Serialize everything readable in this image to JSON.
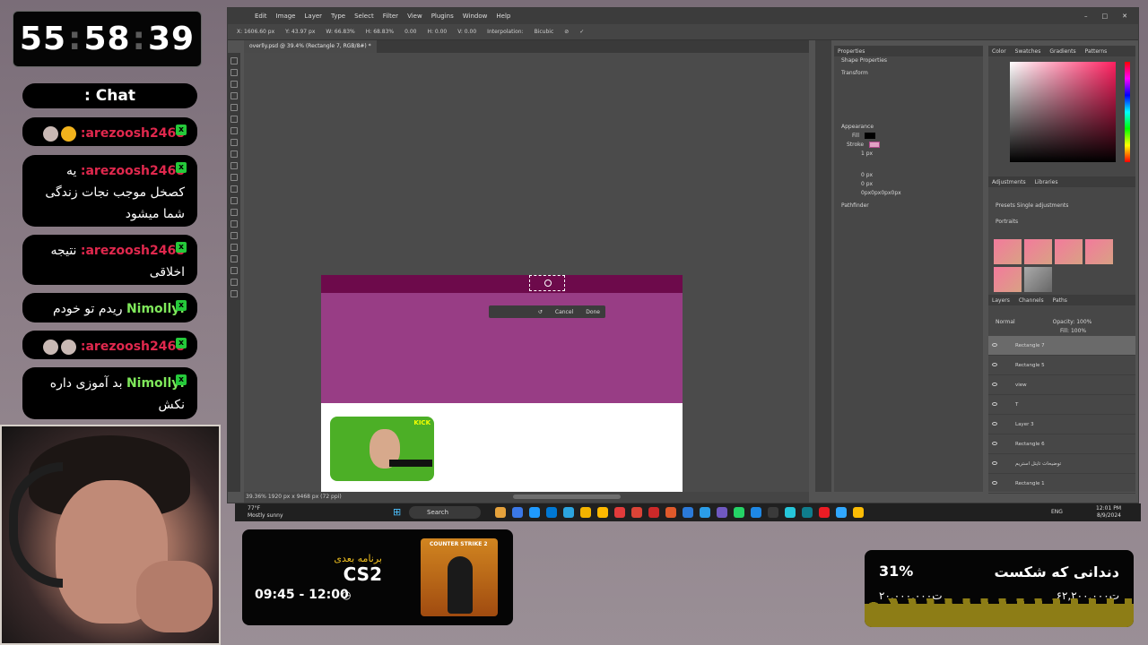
{
  "timer": {
    "h": "55",
    "m": "58",
    "s": "39"
  },
  "chat": {
    "title": ": Chat",
    "messages": [
      {
        "user": ":arezoosh2468",
        "text": ""
      },
      {
        "user": ":arezoosh2468",
        "text": "یه کصخل موجب نجات زندگی شما میشود"
      },
      {
        "user": ":arezoosh2468",
        "text": "نتیجه اخلاقی"
      },
      {
        "user": "Nimolly:",
        "text": "ریدم تو خودم"
      },
      {
        "user": ":arezoosh2468",
        "text": ""
      },
      {
        "user": "Nimolly:",
        "text": "بد آموزی داره نکش"
      }
    ],
    "badge": "x",
    "colors": {
      "user_red": "#e0284d",
      "user_green": "#7fe85b",
      "badge": "#25c93a"
    }
  },
  "photoshop": {
    "menu": [
      "Edit",
      "Image",
      "Layer",
      "Type",
      "Select",
      "Filter",
      "View",
      "Plugins",
      "Window",
      "Help"
    ],
    "options": {
      "x": "X: 1606.60 px",
      "y": "Y: 43.97 px",
      "w": "W: 66.83%",
      "h": "H: 68.83%",
      "angle": "0.00",
      "hskew": "H: 0.00",
      "vskew": "V: 0.00",
      "interp_label": "Interpolation:",
      "interp_value": "Bicubic"
    },
    "tab": "overlly.psd @ 39.4% (Rectangle 7, RGB/8#) *",
    "transform": {
      "cancel": "Cancel",
      "done": "Done"
    },
    "status": {
      "zoom": "39.36%",
      "size": "1920 px x 9468 px (72 ppi)"
    },
    "thumb_tag": "KICK",
    "properties": {
      "tabs": [
        "Properties"
      ],
      "subtitle": "Shape Properties",
      "sections": {
        "transform": "Transform",
        "appearance": "Appearance",
        "pathfinder": "Pathfinder"
      },
      "fill_label": "Fill",
      "stroke_label": "Stroke",
      "stroke_size": "1 px",
      "radius": "0 px",
      "corner": "0px0px0px0px"
    },
    "color": {
      "tabs": [
        "Color",
        "Swatches",
        "Gradients",
        "Patterns"
      ]
    },
    "adjustments": {
      "tabs": [
        "Adjustments",
        "Libraries"
      ],
      "subtabs": [
        "Presets",
        "Single adjustments"
      ],
      "group": "Portraits"
    },
    "layers": {
      "tabs": [
        "Layers",
        "Channels",
        "Paths"
      ],
      "blend": "Normal",
      "opacity_label": "Opacity:",
      "opacity": "100%",
      "fill_label": "Fill:",
      "fill": "100%",
      "items": [
        "Rectangle 7",
        "Rectangle 5",
        "view",
        "",
        "Layer 3",
        "Rectangle 6",
        "توضیحات تایتل استریم",
        "Rectangle 1"
      ]
    }
  },
  "taskbar": {
    "temp": "77°F",
    "weather": "Mostly sunny",
    "search": "Search",
    "lang": "ENG",
    "time": "12:01 PM",
    "date": "8/9/2024",
    "icon_colors": [
      "#e6a23c",
      "#3b78e7",
      "#1f9aff",
      "#0078d4",
      "#2ca5e0",
      "#f4b400",
      "#ffb900",
      "#e23b3b",
      "#db4437",
      "#cc2929",
      "#e05a2b",
      "#2b7ad9",
      "#2b9de8",
      "#7059c1",
      "#25d366",
      "#1e88e5",
      "#3a3a3a",
      "#26c6da",
      "#0f7d8c",
      "#ec1c24",
      "#31a8ff",
      "#fbbc05"
    ]
  },
  "next": {
    "label": "برنامه بعدی",
    "game": "CS2",
    "time": "09:45 - 12:00",
    "cover_text": "COUNTER STRIKE 2"
  },
  "goal": {
    "percent": "31%",
    "title": "دندانی که شکست",
    "current": "۲۰,۰۰۰,۰۰۰ت",
    "target": "۶۲,۲۰۰,۰۰۰ت",
    "progress_fraction": 0.31
  }
}
